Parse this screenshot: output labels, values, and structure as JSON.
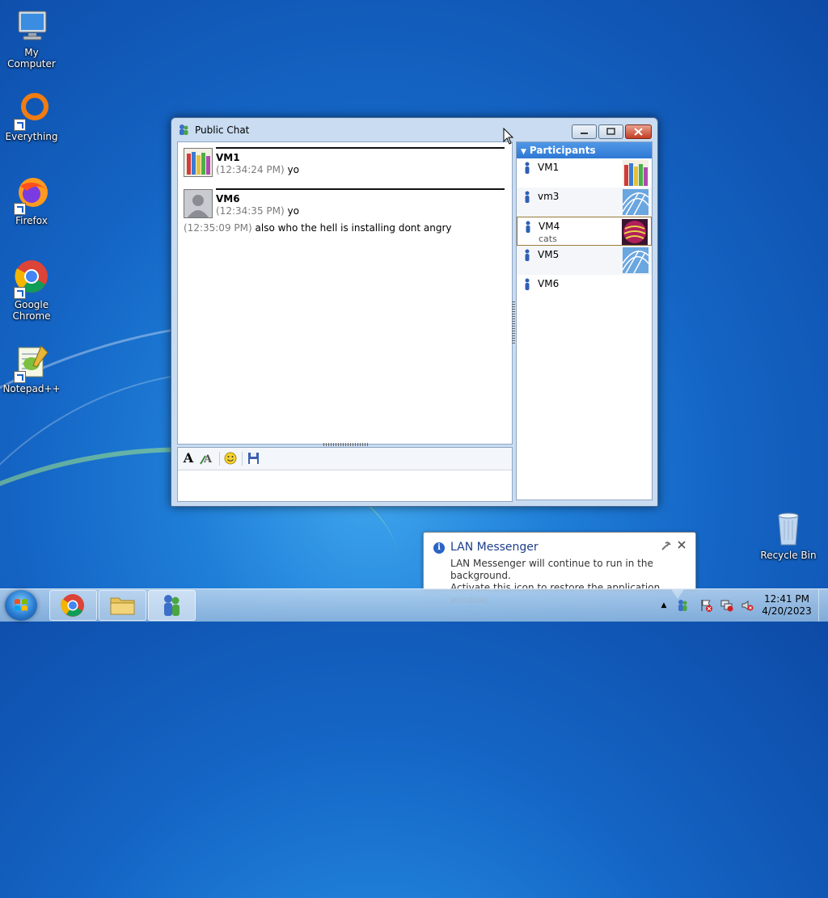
{
  "desktop": {
    "icons": [
      {
        "label": "My Computer"
      },
      {
        "label": "Everything"
      },
      {
        "label": "Firefox"
      },
      {
        "label": "Google Chrome"
      },
      {
        "label": "Notepad++"
      },
      {
        "label": "Recycle Bin"
      }
    ]
  },
  "window": {
    "title": "Public Chat",
    "messages": [
      {
        "sender": "VM1",
        "time": "(12:34:24 PM)",
        "text": "yo"
      },
      {
        "sender": "VM6",
        "time": "(12:34:35 PM)",
        "text": "yo",
        "extra_time": "(12:35:09 PM)",
        "extra_text": "also who the hell is installing dont angry"
      }
    ],
    "input_value": "",
    "participants": {
      "header": "Participants",
      "list": [
        {
          "name": "VM1",
          "status": ""
        },
        {
          "name": "vm3",
          "status": ""
        },
        {
          "name": "VM4",
          "status": "cats"
        },
        {
          "name": "VM5",
          "status": ""
        },
        {
          "name": "VM6",
          "status": ""
        }
      ]
    }
  },
  "notification": {
    "title": "LAN Messenger",
    "line1": "LAN Messenger will continue to run in the background.",
    "line2": "Activate this icon to restore the application window."
  },
  "taskbar": {
    "time": "12:41 PM",
    "date": "4/20/2023"
  },
  "colors": {
    "accent": "#2f78d4",
    "title_text": "#1e3f8a"
  }
}
